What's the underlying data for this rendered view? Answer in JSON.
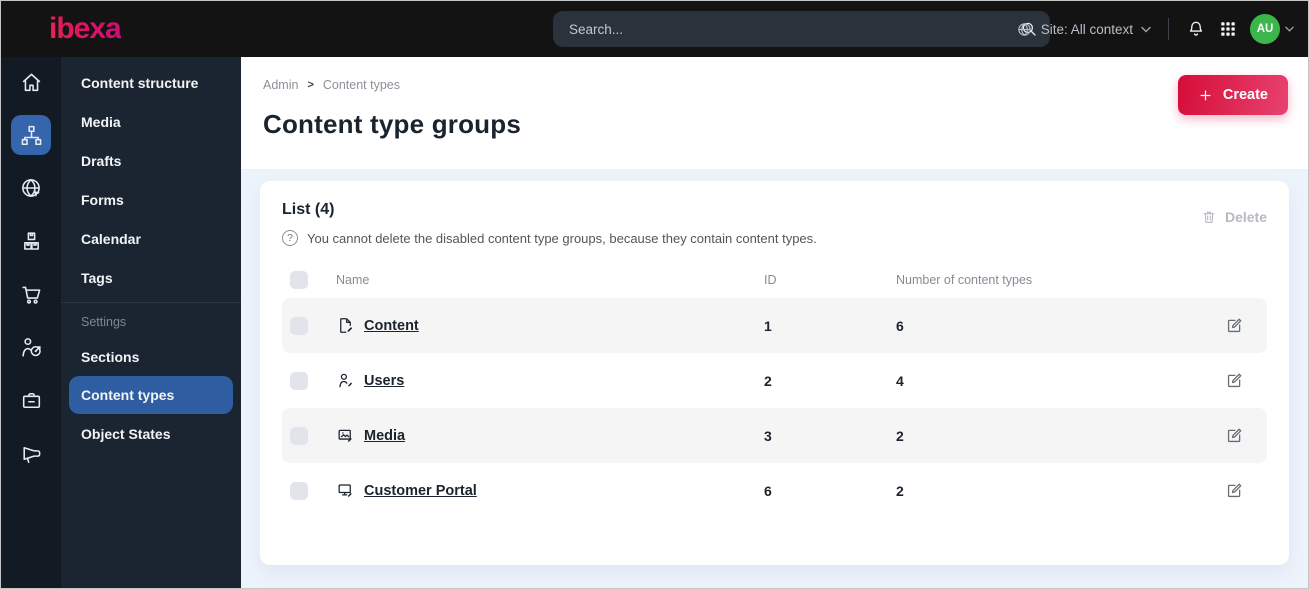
{
  "topbar": {
    "logo": "ibexa",
    "search_placeholder": "Search...",
    "site_context": "Site: All context",
    "avatar_initials": "AU"
  },
  "sidebar": {
    "rail_icons": [
      "home",
      "content-structure",
      "site-globe",
      "product-catalog",
      "shopping-cart",
      "personalization",
      "admin-badge",
      "megaphone"
    ],
    "rail_active": "content-structure",
    "menu_items": [
      "Content structure",
      "Media",
      "Drafts",
      "Forms",
      "Calendar",
      "Tags"
    ],
    "settings_label": "Settings",
    "settings_items": [
      "Sections",
      "Content types",
      "Object States"
    ],
    "active_item": "Content types"
  },
  "main": {
    "breadcrumb": {
      "items": [
        "Admin",
        "Content types"
      ],
      "separator": ">"
    },
    "create_button": "Create",
    "page_title": "Content type groups",
    "list": {
      "heading": "List (4)",
      "help_note": "You cannot delete the disabled content type groups, because they contain content types.",
      "delete_button": "Delete",
      "columns": [
        "Name",
        "ID",
        "Number of content types"
      ],
      "rows": [
        {
          "icon": "content-file",
          "name": "Content",
          "id": "1",
          "count": "6"
        },
        {
          "icon": "user",
          "name": "Users",
          "id": "2",
          "count": "4"
        },
        {
          "icon": "media-image",
          "name": "Media",
          "id": "3",
          "count": "2"
        },
        {
          "icon": "customer-portal",
          "name": "Customer Portal",
          "id": "6",
          "count": "2"
        }
      ]
    }
  },
  "colors": {
    "topbar_bg": "#131313",
    "sidebar_rail_bg": "#121a24",
    "sidebar_menu_bg": "#1b2531",
    "active_blue": "#3565ab",
    "brand_gradient_start": "#d50d38",
    "brand_gradient_end": "#e84270",
    "avatar_green": "#3cb54a",
    "main_tint": "#edf3fb",
    "row_stripe": "#f5f5f6"
  }
}
